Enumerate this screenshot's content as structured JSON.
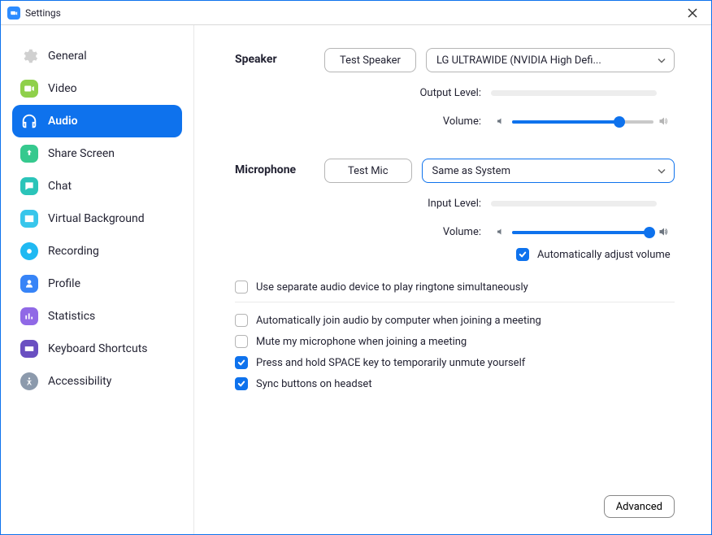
{
  "window": {
    "title": "Settings"
  },
  "sidebar": {
    "items": [
      {
        "label": "General"
      },
      {
        "label": "Video"
      },
      {
        "label": "Audio"
      },
      {
        "label": "Share Screen"
      },
      {
        "label": "Chat"
      },
      {
        "label": "Virtual Background"
      },
      {
        "label": "Recording"
      },
      {
        "label": "Profile"
      },
      {
        "label": "Statistics"
      },
      {
        "label": "Keyboard Shortcuts"
      },
      {
        "label": "Accessibility"
      }
    ]
  },
  "speaker": {
    "heading": "Speaker",
    "test_button": "Test Speaker",
    "device": "LG ULTRAWIDE (NVIDIA High Defi...",
    "output_level_label": "Output Level:",
    "volume_label": "Volume:",
    "volume_percent": 76
  },
  "microphone": {
    "heading": "Microphone",
    "test_button": "Test Mic",
    "device": "Same as System",
    "input_level_label": "Input Level:",
    "volume_label": "Volume:",
    "volume_percent": 97,
    "auto_adjust_label": "Automatically adjust volume"
  },
  "options": {
    "separate_ringtone": "Use separate audio device to play ringtone simultaneously",
    "auto_join_audio": "Automatically join audio by computer when joining a meeting",
    "mute_on_join": "Mute my microphone when joining a meeting",
    "space_unmute": "Press and hold SPACE key to temporarily unmute yourself",
    "sync_headset": "Sync buttons on headset"
  },
  "footer": {
    "advanced": "Advanced"
  }
}
